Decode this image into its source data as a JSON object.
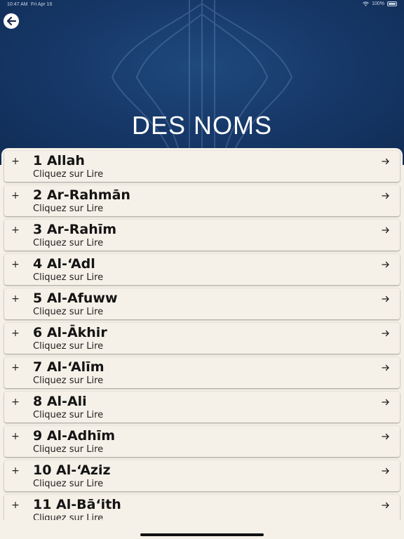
{
  "status_bar": {
    "time": "10:47 AM",
    "date": "Fri Apr 16",
    "battery": "100%"
  },
  "header": {
    "title": "DES NOMS",
    "back_icon": "arrow-left-icon"
  },
  "list": {
    "expand_icon": "plus-icon",
    "open_icon": "arrow-right-icon",
    "items": [
      {
        "name": "1 Allah",
        "subtitle": "Cliquez sur Lire"
      },
      {
        "name": "2 Ar-Rahmān",
        "subtitle": "Cliquez sur Lire"
      },
      {
        "name": "3 Ar-Rahīm",
        "subtitle": "Cliquez sur Lire"
      },
      {
        "name": "4 Al-‘Adl",
        "subtitle": "Cliquez sur Lire"
      },
      {
        "name": "5 Al-Afuww",
        "subtitle": "Cliquez sur Lire"
      },
      {
        "name": "6 Al-Ākhir",
        "subtitle": "Cliquez sur Lire"
      },
      {
        "name": "7 Al-‘Alīm",
        "subtitle": "Cliquez sur Lire"
      },
      {
        "name": "8 Al-Ali",
        "subtitle": "Cliquez sur Lire"
      },
      {
        "name": "9 Al-Adhīm",
        "subtitle": "Cliquez sur Lire"
      },
      {
        "name": "10 Al-‘Aziz",
        "subtitle": "Cliquez sur Lire"
      },
      {
        "name": "11 Al-Bā‘ith",
        "subtitle": "Cliquez sur Lire"
      }
    ]
  },
  "colors": {
    "header_bg": "#17396a",
    "sheet_bg": "#f6f1e8",
    "title_text": "#ffffff"
  }
}
